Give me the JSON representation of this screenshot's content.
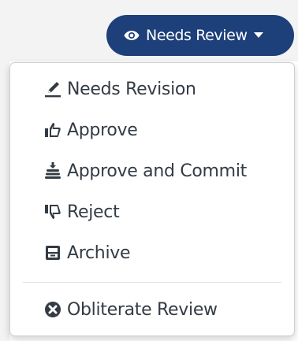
{
  "status_button": {
    "label": "Needs Review",
    "icon": "eye-icon",
    "caret_icon": "caret-down-icon",
    "background": "#1d3f7a",
    "text_color": "#ffffff"
  },
  "menu": {
    "items": [
      {
        "label": "Needs Revision",
        "icon": "pen-icon"
      },
      {
        "label": "Approve",
        "icon": "thumbs-up-icon"
      },
      {
        "label": "Approve and Commit",
        "icon": "coin-stack-icon"
      },
      {
        "label": "Reject",
        "icon": "thumbs-down-icon"
      },
      {
        "label": "Archive",
        "icon": "archive-box-icon"
      }
    ],
    "destructive_items": [
      {
        "label": "Obliterate Review",
        "icon": "times-circle-icon"
      }
    ],
    "text_color": "#333b44"
  }
}
